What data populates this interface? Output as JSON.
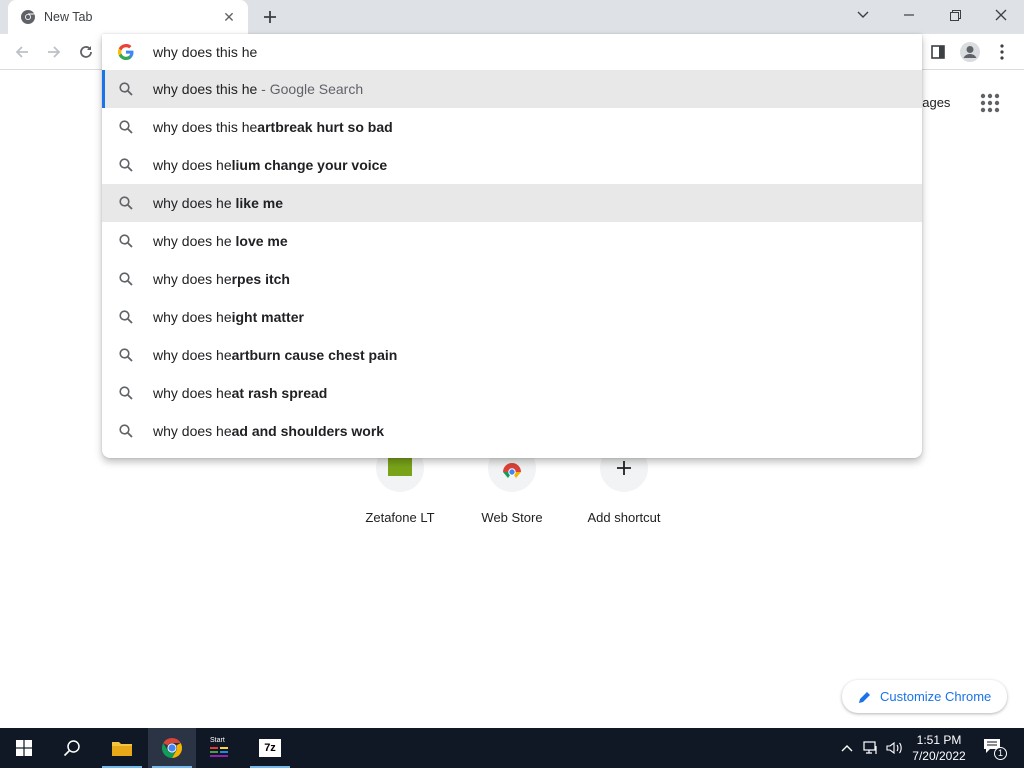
{
  "tab": {
    "title": "New Tab",
    "close_glyph": "✕"
  },
  "omnibox": {
    "value": "why does this he",
    "suggestions": [
      {
        "prefix": "why does this he",
        "bold": "",
        "suffix": " - Google Search"
      },
      {
        "prefix": "why does this he",
        "bold": "artbreak hurt so bad",
        "suffix": ""
      },
      {
        "prefix": "why does he",
        "bold": "lium change your voice",
        "suffix": ""
      },
      {
        "prefix": "why does he",
        "bold": " like me",
        "suffix": ""
      },
      {
        "prefix": "why does he",
        "bold": " love me",
        "suffix": ""
      },
      {
        "prefix": "why does he",
        "bold": "rpes itch",
        "suffix": ""
      },
      {
        "prefix": "why does he",
        "bold": "ight matter",
        "suffix": ""
      },
      {
        "prefix": "why does he",
        "bold": "artburn cause chest pain",
        "suffix": ""
      },
      {
        "prefix": "why does he",
        "bold": "at rash spread",
        "suffix": ""
      },
      {
        "prefix": "why does he",
        "bold": "ad and shoulders work",
        "suffix": ""
      }
    ]
  },
  "page": {
    "images_link": "nages",
    "shortcuts": [
      {
        "label": "Zetafone LT",
        "icon": "zetafone-icon"
      },
      {
        "label": "Web Store",
        "icon": "web-store-icon"
      },
      {
        "label": "Add shortcut",
        "icon": "plus-icon"
      }
    ],
    "customize_label": "Customize Chrome"
  },
  "taskbar": {
    "time": "1:51 PM",
    "date": "7/20/2022",
    "notification_count": "1",
    "start_label": "Start"
  },
  "colors": {
    "accent": "#1a73e8",
    "tab_strip": "#dee1e6",
    "taskbar": "#101826",
    "highlight": "#e8e8e9"
  }
}
